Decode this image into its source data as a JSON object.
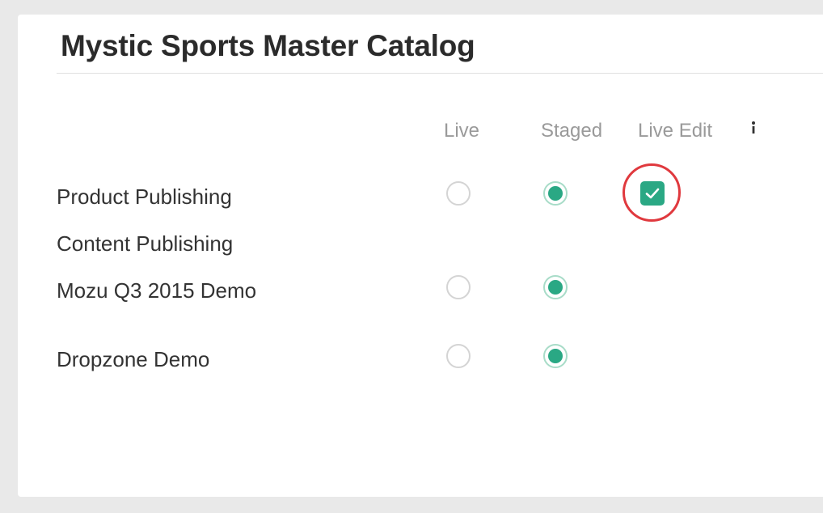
{
  "catalog": {
    "title": "Mystic Sports Master Catalog"
  },
  "columns": {
    "live": "Live",
    "staged": "Staged",
    "live_edit": "Live Edit"
  },
  "rows": [
    {
      "label": "Product Publishing",
      "live": false,
      "staged": true,
      "live_edit": true
    },
    {
      "label": "Content Publishing"
    },
    {
      "label": "Mozu Q3 2015 Demo",
      "live": false,
      "staged": true
    },
    {
      "label": "Dropzone Demo",
      "live": false,
      "staged": true
    }
  ],
  "colors": {
    "accent": "#2aa884",
    "highlight_ring": "#e0393e"
  },
  "icons": {
    "info": "info-icon",
    "checkmark": "checkmark-icon"
  }
}
